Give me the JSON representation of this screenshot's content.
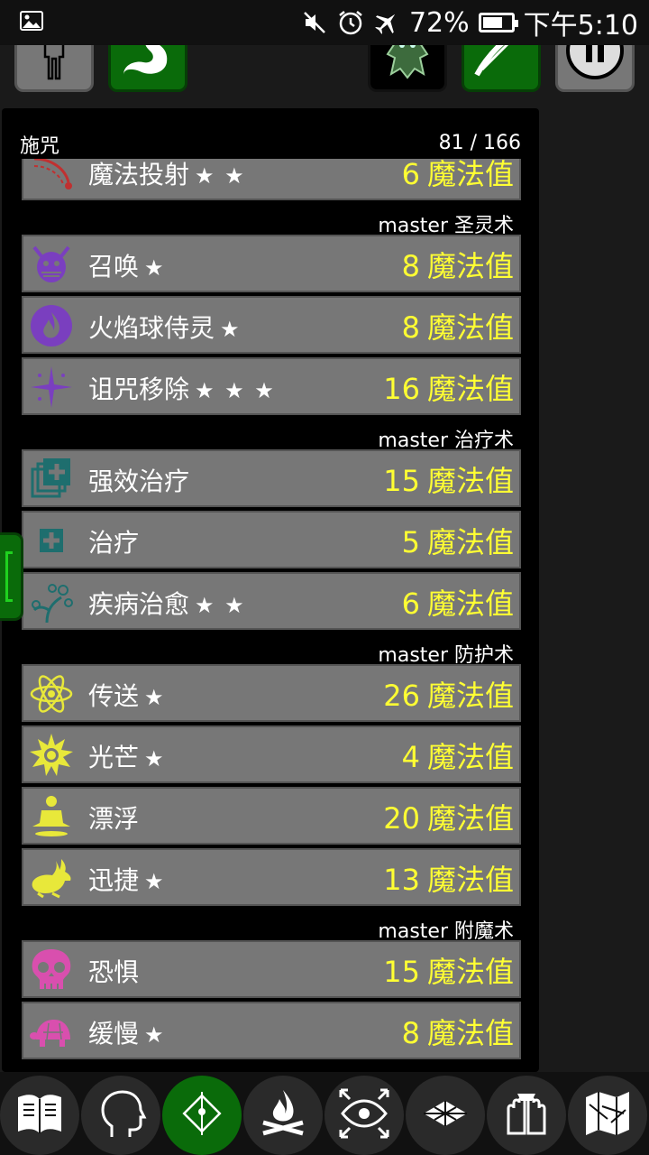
{
  "status_bar": {
    "battery_percent": "72%",
    "time": "下午5:10",
    "icons": [
      "image-icon",
      "mute-icon",
      "alarm-icon",
      "airplane-icon"
    ]
  },
  "top_buttons": [
    "character-icon",
    "hunger-stomach-icon",
    "creature-icon",
    "bow-arrows-icon",
    "pause-icon"
  ],
  "panel": {
    "title": "施咒",
    "count": "81 / 166"
  },
  "cost_unit": "魔法值",
  "list": [
    {
      "type": "spell",
      "name": "魔法投射",
      "stars": "★ ★",
      "cost": "6",
      "icon": "magic-missile-icon",
      "color": "#c03030"
    },
    {
      "type": "school",
      "label": "master 圣灵术"
    },
    {
      "type": "spell",
      "name": "召唤",
      "stars": "★",
      "cost": "8",
      "icon": "summon-demon-icon",
      "color": "#7a3fbf"
    },
    {
      "type": "spell",
      "name": "火焰球侍灵",
      "stars": "★",
      "cost": "8",
      "icon": "flame-orb-icon",
      "color": "#7a3fbf"
    },
    {
      "type": "spell",
      "name": "诅咒移除",
      "stars": "★ ★ ★",
      "cost": "16",
      "icon": "sparkle-icon",
      "color": "#7a3fbf"
    },
    {
      "type": "school",
      "label": "master 治疗术"
    },
    {
      "type": "spell",
      "name": "强效治疗",
      "stars": "",
      "cost": "15",
      "icon": "greater-heal-icon",
      "color": "#1e6e6e"
    },
    {
      "type": "spell",
      "name": "治疗",
      "stars": "",
      "cost": "5",
      "icon": "heal-cross-icon",
      "color": "#1e6e6e"
    },
    {
      "type": "spell",
      "name": "疾病治愈",
      "stars": "★ ★",
      "cost": "6",
      "icon": "cure-plant-icon",
      "color": "#1e6e6e"
    },
    {
      "type": "school",
      "label": "master 防护术"
    },
    {
      "type": "spell",
      "name": "传送",
      "stars": "★",
      "cost": "26",
      "icon": "atom-icon",
      "color": "#e8e83a"
    },
    {
      "type": "spell",
      "name": "光芒",
      "stars": "★",
      "cost": "4",
      "icon": "sun-icon",
      "color": "#e8e83a"
    },
    {
      "type": "spell",
      "name": "漂浮",
      "stars": "",
      "cost": "20",
      "icon": "levitate-icon",
      "color": "#e8e83a"
    },
    {
      "type": "spell",
      "name": "迅捷",
      "stars": "★",
      "cost": "13",
      "icon": "rabbit-icon",
      "color": "#e8e83a"
    },
    {
      "type": "school",
      "label": "master 附魔术"
    },
    {
      "type": "spell",
      "name": "恐惧",
      "stars": "",
      "cost": "15",
      "icon": "skull-icon",
      "color": "#d94fae"
    },
    {
      "type": "spell",
      "name": "缓慢",
      "stars": "★",
      "cost": "8",
      "icon": "turtle-icon",
      "color": "#d94fae"
    }
  ],
  "bottom_nav": [
    "spellbook-icon",
    "head-profile-icon",
    "cast-spell-icon",
    "campfire-icon",
    "look-eye-icon",
    "floor-grid-icon",
    "inventory-hands-icon",
    "map-icon"
  ],
  "active_nav_index": 2
}
